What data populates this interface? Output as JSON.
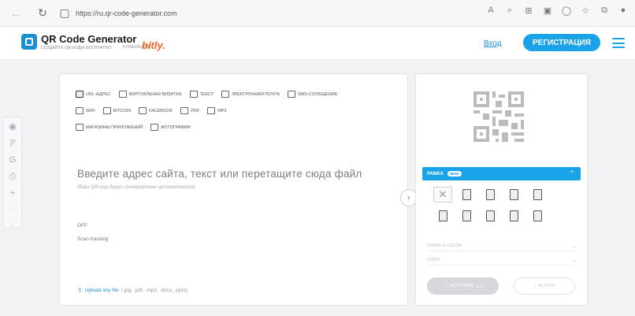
{
  "browser": {
    "url": "https://ru.qr-code-generator.com"
  },
  "header": {
    "title": "QR Code Generator",
    "subtitle": "СОЗДАЙТЕ QR-КОДЫ БЕСПЛАТНО",
    "powered_by": "POWERED BY",
    "partner": "bitly.",
    "login": "Вход",
    "register": "РЕГИСТРАЦИЯ"
  },
  "types": [
    [
      {
        "label": "URL-АДРЕС",
        "icon": "url-icon",
        "active": true
      },
      {
        "label": "ВИРТУАЛЬНАЯ ВИЗИТКА",
        "icon": "vcard-icon"
      },
      {
        "label": "ТЕКСТ",
        "icon": "text-icon"
      },
      {
        "label": "ЭЛЕКТРОННАЯ ПОЧТА",
        "icon": "email-icon"
      },
      {
        "label": "SMS-СООБЩЕНИЕ",
        "icon": "sms-icon"
      }
    ],
    [
      {
        "label": "WIFI",
        "icon": "wifi-icon"
      },
      {
        "label": "BITCOIN",
        "icon": "bitcoin-icon"
      },
      {
        "label": "FACEBOOK",
        "icon": "facebook-icon"
      },
      {
        "label": "PDF",
        "icon": "pdf-icon"
      },
      {
        "label": "MP3",
        "icon": "mp3-icon"
      }
    ],
    [
      {
        "label": "МАГАЗИНЫ ПРИЛОЖЕНИЙ",
        "icon": "app-store-icon"
      },
      {
        "label": "ФОТОГРАФИИ",
        "icon": "photo-icon"
      }
    ]
  ],
  "main": {
    "title": "Введите адрес сайта, текст или перетащите сюда файл",
    "subtitle": "(Ваш QR-код будет сгенерирован автоматически)",
    "off": "OFF",
    "scan_tracking": "Scan tracking",
    "upload_link": "Upload any file",
    "upload_types": "(.jpg, .pdf, .mp3, .docx, .pptx)"
  },
  "right": {
    "frame_title": "РАМКА",
    "new_badge": "NEW!",
    "shape_color": "SHAPE & COLOR",
    "logo": "LOGO",
    "download": "ЗАГРУЗИТЬ",
    "download_sub": "JPG",
    "vector": "ВЕКТОР"
  }
}
